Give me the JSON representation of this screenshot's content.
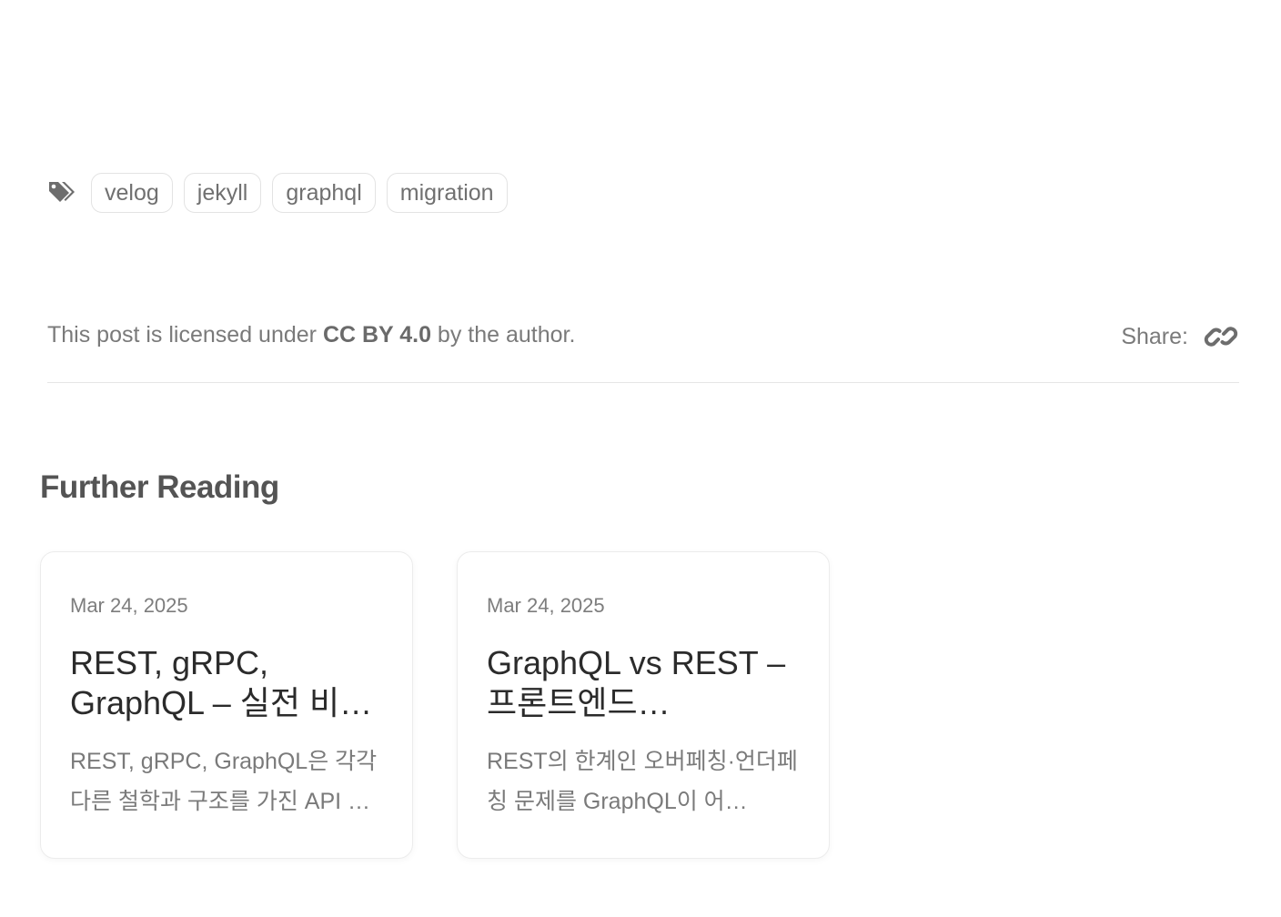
{
  "tags": {
    "icon": "tags-icon",
    "items": [
      {
        "label": "velog"
      },
      {
        "label": "jekyll"
      },
      {
        "label": "graphql"
      },
      {
        "label": "migration"
      }
    ]
  },
  "license": {
    "prefix": "This post is licensed under ",
    "license_name": "CC BY 4.0",
    "suffix": " by the author."
  },
  "share": {
    "label": "Share:",
    "icon": "link-icon"
  },
  "further_reading": {
    "title": "Further Reading",
    "cards": [
      {
        "date": "Mar 24, 2025",
        "title": "REST, gRPC, GraphQL – 실전 비…",
        "excerpt": "REST, gRPC, GraphQL은 각각 다른 철학과 구조를 가진 API …"
      },
      {
        "date": "Mar 24, 2025",
        "title": "GraphQL vs REST – 프론트엔드 친화적인…",
        "excerpt": "REST의 한계인 오버페칭·언더페칭 문제를 GraphQL이 어…"
      }
    ]
  },
  "colors": {
    "text_muted": "#6c6c6d",
    "heading": "#545454",
    "card_title": "#2b2b2b",
    "border": "#e3e3e3"
  }
}
